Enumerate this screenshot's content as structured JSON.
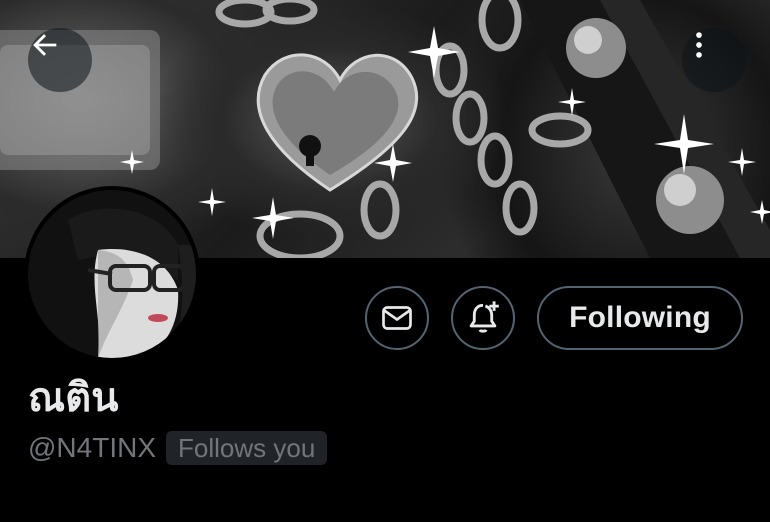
{
  "banner": {
    "alt": "Silver heart padlock, chains and studded leather with sparkles"
  },
  "nav": {
    "back_icon": "arrow-left-icon",
    "more_icon": "more-vertical-icon"
  },
  "actions": {
    "message_icon": "envelope-icon",
    "notify_icon": "bell-plus-icon",
    "following_label": "Following"
  },
  "profile": {
    "display_name": "ณติน",
    "handle": "@N4TINX",
    "follows_you_badge": "Follows you"
  },
  "colors": {
    "background": "#000000",
    "primary_text": "#e7e9ea",
    "secondary_text": "#71767b",
    "border": "#536471",
    "badge_bg": "#202327"
  }
}
